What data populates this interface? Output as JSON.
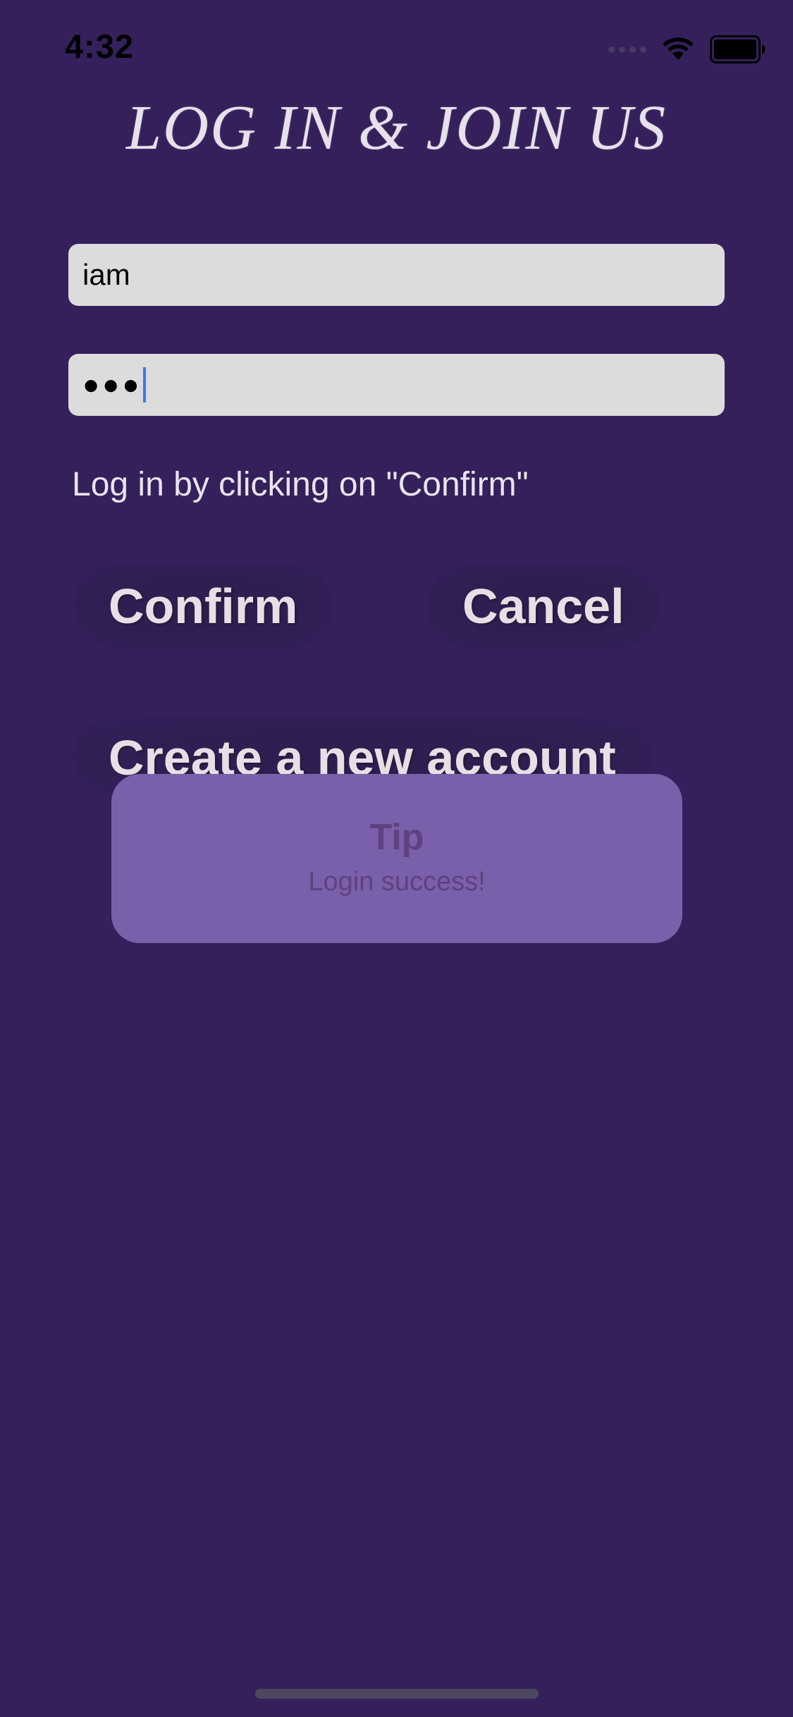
{
  "status_bar": {
    "time": "4:32",
    "icons": [
      "cellular-signal-icon",
      "wifi-icon",
      "battery-icon"
    ]
  },
  "header": {
    "title": "LOG IN & JOIN US"
  },
  "form": {
    "username_value": "iam",
    "password_mask": "●●●"
  },
  "hint_text": "Log in by clicking on \"Confirm\"",
  "buttons": {
    "confirm": "Confirm",
    "cancel": "Cancel",
    "create_account": "Create a new account"
  },
  "toast": {
    "title": "Tip",
    "message": "Login success!"
  },
  "colors": {
    "background": "#35205b",
    "field_background": "#dcdcdc",
    "toast_background": "#7a5faa",
    "caret": "#3478f6"
  }
}
